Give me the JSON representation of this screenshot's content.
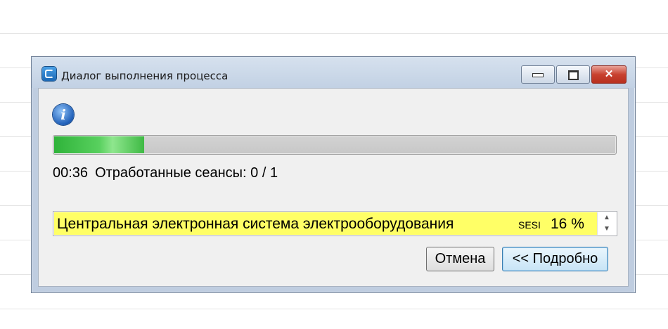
{
  "window": {
    "title": "Диалог выполнения процесса"
  },
  "progress": {
    "fraction": 0.16
  },
  "status": {
    "elapsed": "00:36",
    "sessions_label": "Отработанные сеансы: 0 / 1"
  },
  "sessions": [
    {
      "name": "Центральная электронная система электрооборудования",
      "code": "SESI",
      "percent": "16 %"
    }
  ],
  "buttons": {
    "cancel": "Отмена",
    "details": "<< Подробно"
  },
  "colors": {
    "highlight": "#ffff66",
    "progress": "#3eba44"
  }
}
